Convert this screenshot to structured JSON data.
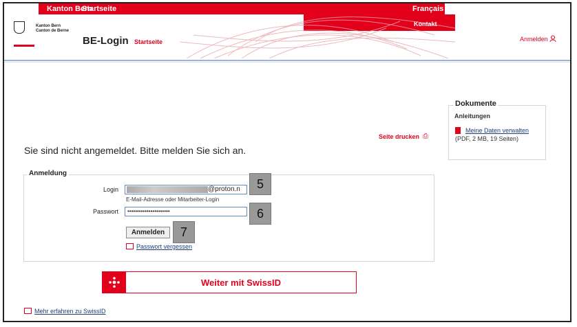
{
  "topbar": {
    "brand": "Kanton Bern",
    "home": "Startseite",
    "lang": "Français",
    "contact": "Kontakt"
  },
  "header": {
    "crest_line1": "Kanton Bern",
    "crest_line2": "Canton de Berne",
    "app_title": "BE-Login",
    "app_link": "Startseite",
    "login_link": "Anmelden"
  },
  "documents": {
    "title": "Dokumente",
    "subtitle": "Anleitungen",
    "link": "Meine Daten verwalten",
    "link_meta": " (PDF, 2 MB, 19 Seiten)"
  },
  "print_label": "Seite drucken",
  "headline": "Sie sind nicht angemeldet. Bitte melden Sie sich an.",
  "form": {
    "legend": "Anmeldung",
    "login_label": "Login",
    "login_value_visible": "@proton.n",
    "login_hint": "E-Mail-Adresse oder Mitarbeiter-Login",
    "password_label": "Passwort",
    "password_value": "••••••••••••••••••••••",
    "submit_label": "Anmelden",
    "forgot_label": "Passwort vergessen"
  },
  "badges": {
    "login": "5",
    "password": "6",
    "submit": "7"
  },
  "swissid": {
    "button_label": "Weiter mit SwissID",
    "more_label": "Mehr erfahren zu SwissID"
  },
  "colors": {
    "brand_red": "#e3001b",
    "link_blue": "#1a3d7a",
    "input_border": "#5a8ac6"
  }
}
